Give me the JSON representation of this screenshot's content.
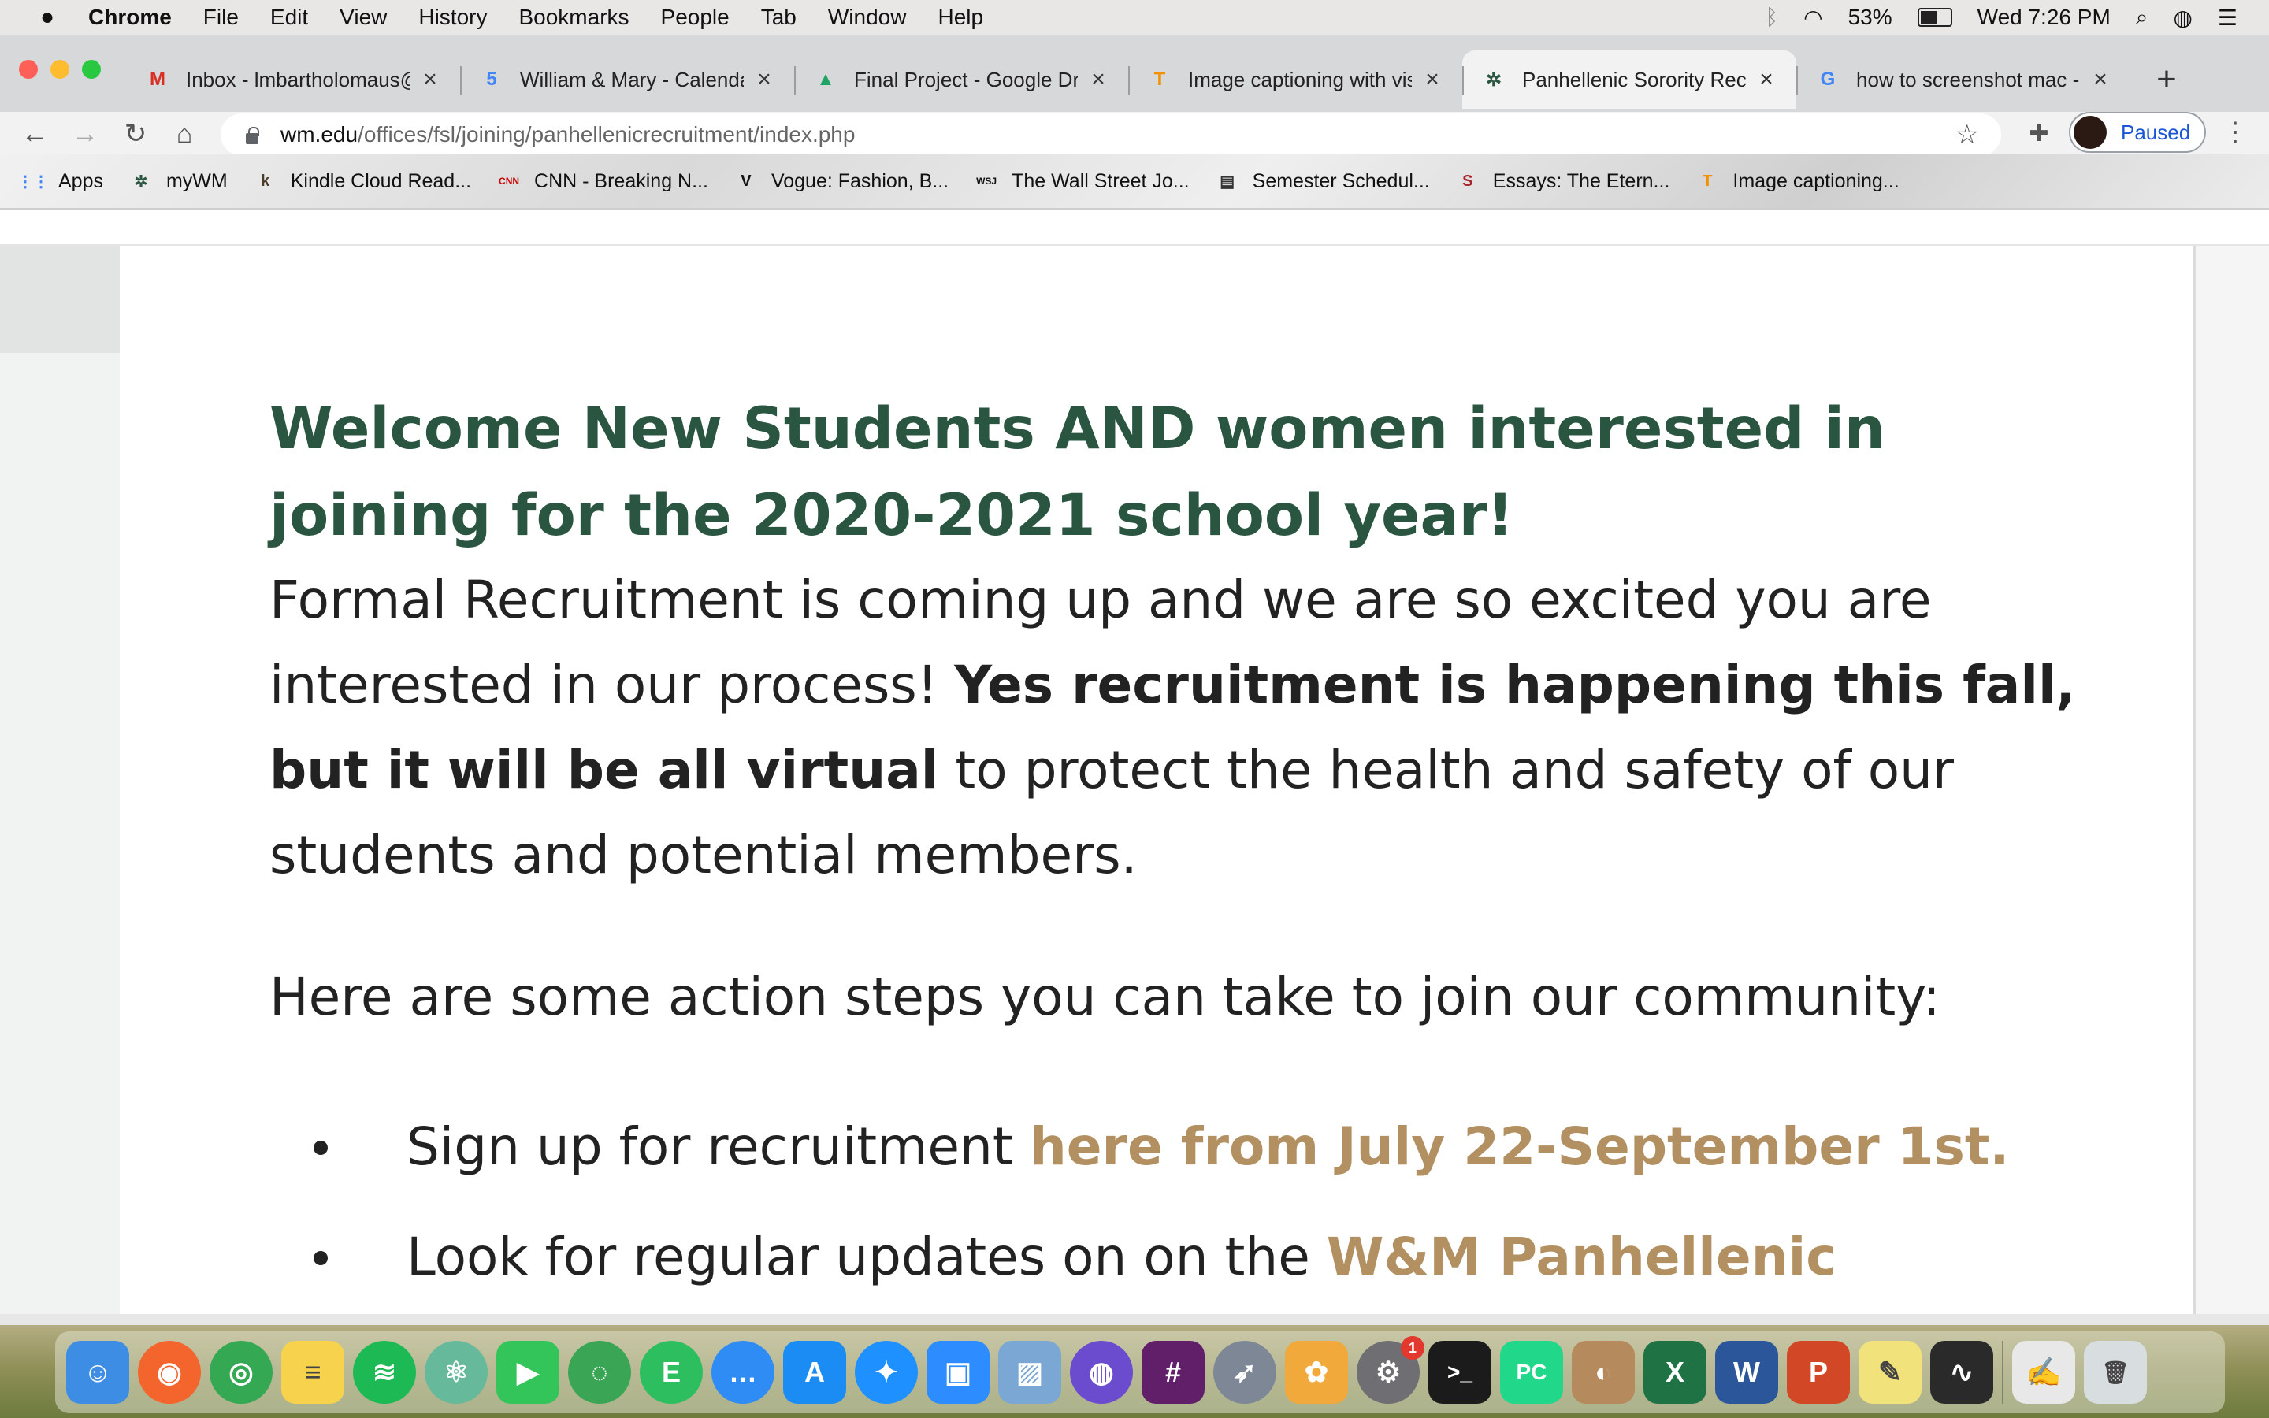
{
  "menubar": {
    "app_name": "Chrome",
    "items": [
      "File",
      "Edit",
      "View",
      "History",
      "Bookmarks",
      "People",
      "Tab",
      "Window",
      "Help"
    ],
    "battery": "53%",
    "clock": "Wed 7:26 PM"
  },
  "tabs": [
    {
      "title": "Inbox - lmbartholomaus@",
      "icon": "gmail-icon",
      "favicon_text": "M",
      "color": "#d93025"
    },
    {
      "title": "William & Mary - Calendar",
      "icon": "calendar-icon",
      "favicon_text": "5",
      "color": "#4285f4"
    },
    {
      "title": "Final Project - Google Driv",
      "icon": "google-drive-icon",
      "favicon_text": "▲",
      "color": "#1fa463"
    },
    {
      "title": "Image captioning with visu",
      "icon": "tensorflow-icon",
      "favicon_text": "T",
      "color": "#f29100"
    },
    {
      "title": "Panhellenic Sorority Recru",
      "icon": "wm-cypher-icon",
      "favicon_text": "✲",
      "color": "#2a5641"
    },
    {
      "title": "how to screenshot mac - G",
      "icon": "google-icon",
      "favicon_text": "G",
      "color": "#4285f4"
    }
  ],
  "active_tab_index": 4,
  "toolbar": {
    "url_host": "wm.edu",
    "url_path": "/offices/fsl/joining/panhellenicrecruitment/index.php",
    "profile_label": "Paused"
  },
  "bookmarks": [
    {
      "label": "Apps",
      "icon": "apps-grid-icon",
      "glyph": "⋮⋮",
      "color": "#4285f4"
    },
    {
      "label": "myWM",
      "icon": "wm-cypher-icon",
      "glyph": "✲",
      "color": "#2a5641"
    },
    {
      "label": "Kindle Cloud Read...",
      "icon": "kindle-icon",
      "glyph": "k",
      "color": "#4a3b2b"
    },
    {
      "label": "CNN - Breaking N...",
      "icon": "cnn-icon",
      "glyph": "CNN",
      "color": "#cc0000"
    },
    {
      "label": "Vogue: Fashion, B...",
      "icon": "vogue-icon",
      "glyph": "V",
      "color": "#111111"
    },
    {
      "label": "The Wall Street Jo...",
      "icon": "wsj-icon",
      "glyph": "WSJ",
      "color": "#111111"
    },
    {
      "label": "Semester Schedul...",
      "icon": "notebook-icon",
      "glyph": "▤",
      "color": "#333333"
    },
    {
      "label": "Essays: The Etern...",
      "icon": "scribd-icon",
      "glyph": "S",
      "color": "#a8262a"
    },
    {
      "label": "Image captioning...",
      "icon": "tensorflow-icon",
      "glyph": "T",
      "color": "#f29100"
    }
  ],
  "content": {
    "headline": "Welcome New Students AND women interested in joining for the 2020-2021 school year!",
    "intro_start": "Formal Recruitment is coming up and we are so excited you are interested in our process! ",
    "intro_bold": "Yes recruitment is happening this fall, but it will be all virtual",
    "intro_end": " to protect the health and safety of our students and potential members.",
    "steps_intro": "Here are some action steps you can take to join our community:",
    "step1_text": "Sign up for recruitment ",
    "step1_link": "here from July 22-September 1st.",
    "step2_text": "Look for regular updates on on the ",
    "step2_link": "W&M Panhellenic"
  },
  "colors": {
    "headline_green": "#2a5641",
    "link_gold": "#b39062"
  },
  "dock": [
    {
      "name": "finder-icon",
      "glyph": "☺",
      "color": "#3e8de4"
    },
    {
      "name": "firefox-icon",
      "glyph": "◉",
      "color": "#f4652d"
    },
    {
      "name": "chrome-icon",
      "glyph": "◎",
      "color": "#34a853"
    },
    {
      "name": "notes-icon",
      "glyph": "≡",
      "color": "#f7d24c"
    },
    {
      "name": "spotify-icon",
      "glyph": "≋",
      "color": "#1db954"
    },
    {
      "name": "atom-icon",
      "glyph": "⚛",
      "color": "#66b99b"
    },
    {
      "name": "facetime-icon",
      "glyph": "▶",
      "color": "#33c45a"
    },
    {
      "name": "circle-app-icon",
      "glyph": "◌",
      "color": "#3aa655"
    },
    {
      "name": "evernote-icon",
      "glyph": "E",
      "color": "#2dbe60"
    },
    {
      "name": "messages-icon",
      "glyph": "…",
      "color": "#2f8cf4"
    },
    {
      "name": "app-store-icon",
      "glyph": "A",
      "color": "#1a8cf4"
    },
    {
      "name": "safari-icon",
      "glyph": "✦",
      "color": "#1e90ff"
    },
    {
      "name": "zoom-icon",
      "glyph": "▣",
      "color": "#2d8cff"
    },
    {
      "name": "preview-icon",
      "glyph": "▨",
      "color": "#7aa7d4"
    },
    {
      "name": "siri-icon",
      "glyph": "◍",
      "color": "#6b4ccf"
    },
    {
      "name": "slack-icon",
      "glyph": "#",
      "color": "#611f69"
    },
    {
      "name": "launchpad-icon",
      "glyph": "➶",
      "color": "#7d8796"
    },
    {
      "name": "photos-icon",
      "glyph": "✿",
      "color": "#f2a93b"
    },
    {
      "name": "system-preferences-icon",
      "glyph": "⚙",
      "color": "#6e6e73",
      "badge": "1"
    },
    {
      "name": "terminal-icon",
      "glyph": ">_",
      "color": "#1b1b1b"
    },
    {
      "name": "pycharm-icon",
      "glyph": "PC",
      "color": "#21d789"
    },
    {
      "name": "contacts-icon",
      "glyph": "◐",
      "color": "#b58a5d"
    },
    {
      "name": "excel-icon",
      "glyph": "X",
      "color": "#1f7244"
    },
    {
      "name": "word-icon",
      "glyph": "W",
      "color": "#2b579a"
    },
    {
      "name": "powerpoint-icon",
      "glyph": "P",
      "color": "#d24726"
    },
    {
      "name": "stickies-icon",
      "glyph": "✎",
      "color": "#f2e27c"
    },
    {
      "name": "activity-monitor-icon",
      "glyph": "∿",
      "color": "#2a2a2a"
    },
    {
      "name": "textedit-icon",
      "glyph": "✍",
      "color": "#e8e8e8"
    },
    {
      "name": "trash-icon",
      "glyph": "🗑",
      "color": "#d8dde0"
    }
  ]
}
